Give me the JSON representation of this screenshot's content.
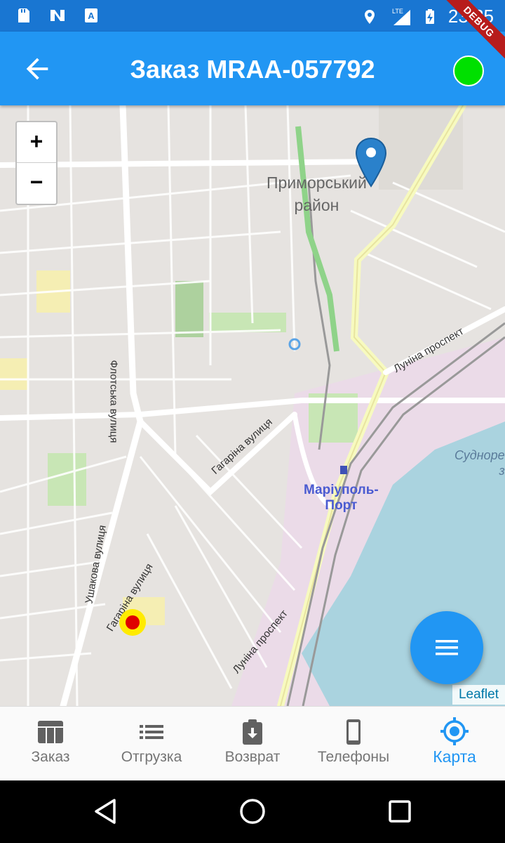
{
  "status_bar": {
    "time": "23:25",
    "network": "LTE",
    "icons": [
      "sd-card-icon",
      "n-notification-icon",
      "a-notification-icon",
      "location-icon",
      "signal-icon",
      "battery-charging-icon"
    ]
  },
  "app_bar": {
    "title": "Заказ MRAA-057792",
    "status_color": "#00e000",
    "debug_banner": "DEBUG"
  },
  "map": {
    "labels": {
      "district_line1": "Приморський",
      "district_line2": "район",
      "flotska": "Флотська вулиця",
      "gagarina1": "Гагаріна вулиця",
      "gagarina2": "Гагаріна вулиця",
      "ushakova": "Ушакова вулиця",
      "lunina1": "Луніна проспект",
      "lunina2": "Луніна проспект",
      "port_line1": "Маріуполь-",
      "port_line2": "Порт",
      "sudno_line1": "Судноре",
      "sudno_line2": "з"
    },
    "zoom_in": "+",
    "zoom_out": "−",
    "attribution": "Leaflet"
  },
  "bottom_nav": {
    "items": [
      {
        "label": "Заказ",
        "icon": "table-icon",
        "active": false
      },
      {
        "label": "Отгрузка",
        "icon": "list-icon",
        "active": false
      },
      {
        "label": "Возврат",
        "icon": "clipboard-download-icon",
        "active": false
      },
      {
        "label": "Телефоны",
        "icon": "phone-icon",
        "active": false
      },
      {
        "label": "Карта",
        "icon": "gps-target-icon",
        "active": true
      }
    ]
  },
  "colors": {
    "primary": "#2196f3",
    "status_bar": "#1976d2",
    "water": "#aad3df",
    "industrial": "#ebdbe8",
    "park": "#aedfa3",
    "marker": "#2a81cb"
  }
}
